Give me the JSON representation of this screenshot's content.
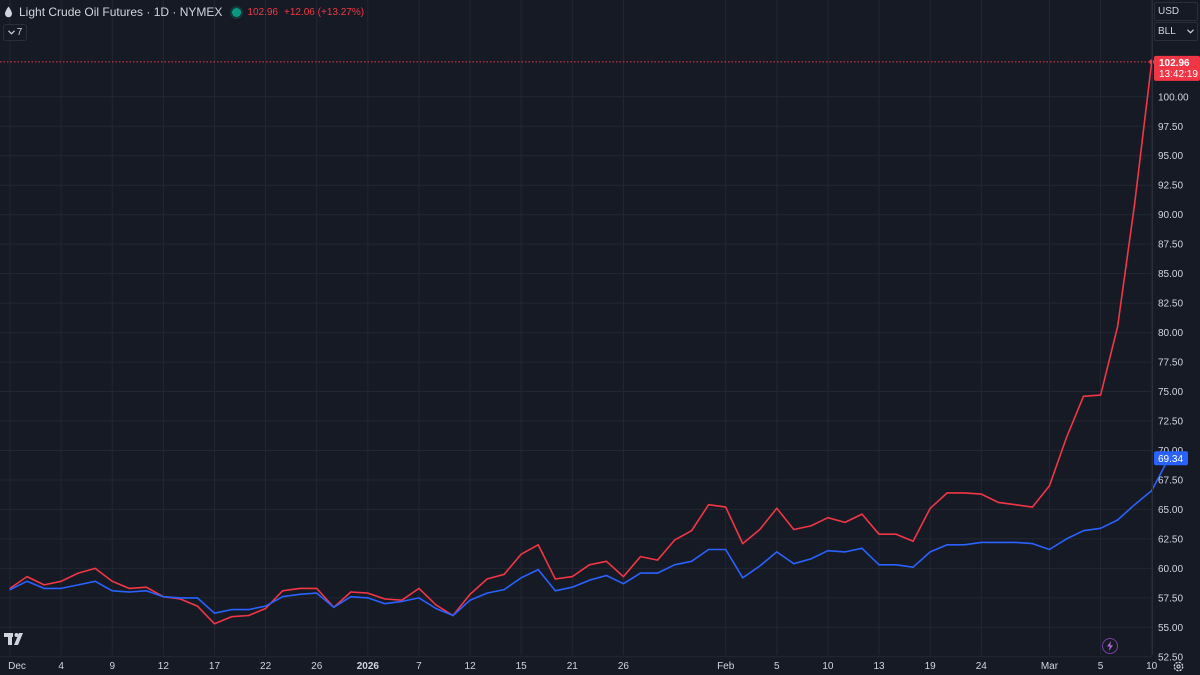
{
  "header": {
    "title": "Light Crude Oil Futures · 1D · NYMEX",
    "price": "102.96",
    "change": "+12.06 (+13.27%)"
  },
  "interval": {
    "label": "7"
  },
  "axis_buttons": {
    "currency": "USD",
    "unit": "BLL"
  },
  "last_price": {
    "value": "102.96",
    "time": "13:42:19"
  },
  "compare_price": {
    "value": "69.34"
  },
  "colors": {
    "background": "#161a25",
    "grid": "#232733",
    "text": "#d1d4dc",
    "primary_series": "#f23645",
    "compare_series": "#2962ff",
    "compare_label": "#2962ff"
  },
  "chart_data": {
    "type": "line",
    "title": "Light Crude Oil Futures · 1D · NYMEX",
    "xlabel": "",
    "ylabel": "",
    "ylim": [
      51.5,
      104.5
    ],
    "yticks": [
      52.5,
      55,
      57.5,
      60,
      62.5,
      65,
      67.5,
      70,
      72.5,
      75,
      77.5,
      80,
      82.5,
      85,
      87.5,
      90,
      92.5,
      95,
      97.5,
      100
    ],
    "ytick_labels": [
      "52.50",
      "55.00",
      "57.50",
      "60.00",
      "62.50",
      "65.00",
      "67.50",
      "70.00",
      "72.50",
      "75.00",
      "77.50",
      "80.00",
      "82.50",
      "85.00",
      "87.50",
      "90.00",
      "92.50",
      "95.00",
      "97.50",
      "100.00"
    ],
    "x_labels": [
      {
        "label": "Dec",
        "i": 0
      },
      {
        "label": "4",
        "i": 3
      },
      {
        "label": "9",
        "i": 6
      },
      {
        "label": "12",
        "i": 9
      },
      {
        "label": "17",
        "i": 12
      },
      {
        "label": "22",
        "i": 15
      },
      {
        "label": "26",
        "i": 18
      },
      {
        "label": "2026",
        "i": 21
      },
      {
        "label": "7",
        "i": 24
      },
      {
        "label": "12",
        "i": 27
      },
      {
        "label": "15",
        "i": 30
      },
      {
        "label": "21",
        "i": 33
      },
      {
        "label": "26",
        "i": 36
      },
      {
        "label": "Feb",
        "i": 42
      },
      {
        "label": "5",
        "i": 45
      },
      {
        "label": "10",
        "i": 48
      },
      {
        "label": "13",
        "i": 51
      },
      {
        "label": "19",
        "i": 54
      },
      {
        "label": "24",
        "i": 57
      },
      {
        "label": "Mar",
        "i": 61
      },
      {
        "label": "5",
        "i": 64
      },
      {
        "label": "10",
        "i": 67
      }
    ],
    "x_bold": [
      "2026"
    ],
    "series": [
      {
        "color": "#f23645",
        "values": [
          58.3,
          59.3,
          58.6,
          58.9,
          59.6,
          60.0,
          58.9,
          58.3,
          58.4,
          57.6,
          57.4,
          56.8,
          55.3,
          55.9,
          56.0,
          56.6,
          58.1,
          58.3,
          58.3,
          56.7,
          58.0,
          57.9,
          57.4,
          57.3,
          58.3,
          56.9,
          56.0,
          57.8,
          59.1,
          59.5,
          61.2,
          62.0,
          59.1,
          59.3,
          60.3,
          60.6,
          59.3,
          61.0,
          60.7,
          62.4,
          63.2,
          65.4,
          65.2,
          62.1,
          63.3,
          65.1,
          63.3,
          63.6,
          64.3,
          63.9,
          64.6,
          62.9,
          62.9,
          62.3,
          65.1,
          66.4,
          66.4,
          66.3,
          65.6,
          65.4,
          65.2,
          67.0,
          71.1,
          74.6,
          74.7,
          80.5,
          90.9,
          102.96
        ]
      },
      {
        "color": "#2962ff",
        "values": [
          58.2,
          58.9,
          58.3,
          58.3,
          58.6,
          58.9,
          58.1,
          58.0,
          58.1,
          57.6,
          57.5,
          57.5,
          56.2,
          56.5,
          56.5,
          56.8,
          57.6,
          57.8,
          57.9,
          56.7,
          57.6,
          57.5,
          57.0,
          57.2,
          57.5,
          56.6,
          56.0,
          57.3,
          57.9,
          58.2,
          59.2,
          59.9,
          58.1,
          58.4,
          59.0,
          59.4,
          58.7,
          59.6,
          59.6,
          60.3,
          60.6,
          61.6,
          61.6,
          59.2,
          60.2,
          61.4,
          60.4,
          60.8,
          61.5,
          61.4,
          61.7,
          60.3,
          60.3,
          60.1,
          61.4,
          62.0,
          62.0,
          62.2,
          62.2,
          62.2,
          62.1,
          61.6,
          62.5,
          63.2,
          63.4,
          64.1,
          65.4,
          66.6,
          69.34
        ]
      }
    ]
  }
}
